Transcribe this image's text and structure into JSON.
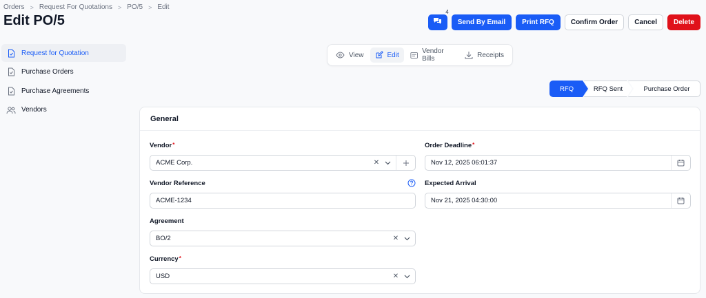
{
  "breadcrumb": [
    "Orders",
    "Request For Quotations",
    "PO/5",
    "Edit"
  ],
  "page_title": "Edit PO/5",
  "actions": {
    "notification_count": "4",
    "send_email": "Send By Email",
    "print_rfq": "Print RFQ",
    "confirm_order": "Confirm Order",
    "cancel": "Cancel",
    "delete": "Delete"
  },
  "sidebar": {
    "items": [
      {
        "label": "Request for Quotation",
        "icon": "document-icon",
        "active": true
      },
      {
        "label": "Purchase Orders",
        "icon": "document-icon"
      },
      {
        "label": "Purchase Agreements",
        "icon": "document-icon"
      },
      {
        "label": "Vendors",
        "icon": "users-icon"
      }
    ]
  },
  "view_tabs": [
    "View",
    "Edit",
    "Vendor Bills",
    "Receipts"
  ],
  "stages": [
    "RFQ",
    "RFQ Sent",
    "Purchase Order"
  ],
  "form": {
    "section_title": "General",
    "vendor": {
      "label": "Vendor",
      "value": "ACME Corp."
    },
    "order_deadline": {
      "label": "Order Deadline",
      "value": "Nov 12, 2025 06:01:37"
    },
    "vendor_reference": {
      "label": "Vendor Reference",
      "value": "ACME-1234"
    },
    "expected_arrival": {
      "label": "Expected Arrival",
      "value": "Nov 21, 2025 04:30:00"
    },
    "agreement": {
      "label": "Agreement",
      "value": "BO/2"
    },
    "currency": {
      "label": "Currency",
      "value": "USD"
    }
  },
  "colors": {
    "primary": "#1a5cf6",
    "danger": "#e0111a"
  }
}
